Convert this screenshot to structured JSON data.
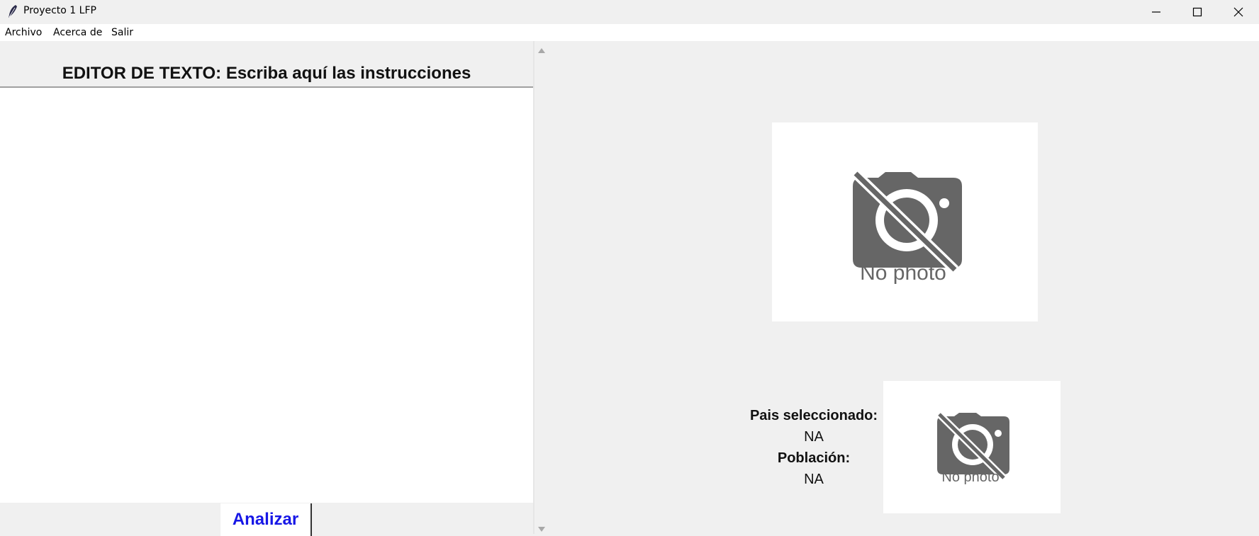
{
  "window": {
    "title": "Proyecto 1 LFP"
  },
  "menu": {
    "items": [
      "Archivo",
      "Acerca de",
      "Salir"
    ]
  },
  "editor": {
    "heading": "EDITOR DE TEXTO: Escriba aquí las instrucciones",
    "content": "",
    "analyze_label": "Analizar"
  },
  "preview": {
    "big_photo_text": "No photo",
    "small_photo_text": "No photo",
    "country_label": "Pais seleccionado:",
    "country_value": "NA",
    "population_label": "Población:",
    "population_value": "NA"
  },
  "icons": {
    "app": "feather-icon",
    "minimize": "minimize-icon",
    "maximize": "maximize-icon",
    "close": "close-icon",
    "camera": "camera-off-icon"
  },
  "colors": {
    "analyze_text": "#1717e6",
    "camera_gray": "#666666"
  }
}
